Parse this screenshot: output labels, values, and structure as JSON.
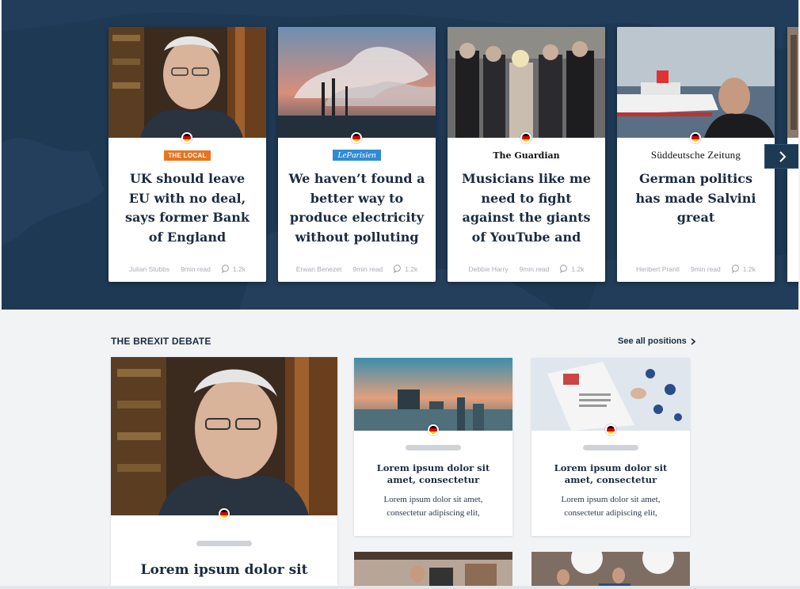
{
  "hero": {
    "next_label": "next",
    "cards": [
      {
        "source": "THE LOCAL",
        "source_style": "local",
        "title": "UK should leave EU with no deal, says former Bank of England governor",
        "author": "Julian Stubbs",
        "read_time": "9min read",
        "comments": "1.2k",
        "flag": "germany-flag-icon"
      },
      {
        "source": "LeParisien",
        "source_style": "parisien",
        "title": "We haven’t found a better way to produce electricity without polluting",
        "author": "Erwan Benezet",
        "read_time": "9min read",
        "comments": "1.2k",
        "flag": "germany-flag-icon"
      },
      {
        "source": "The Guardian",
        "source_style": "guardian",
        "title": "Musicians like me need to fight against the giants of YouTube and",
        "author": "Debbie Harry",
        "read_time": "9min read",
        "comments": "1.2k",
        "flag": "germany-flag-icon"
      },
      {
        "source": "Süddeutsche Zeitung",
        "source_style": "sz",
        "title": "German politics has made Salvini great",
        "author": "Heribert Prantl",
        "read_time": "9min read",
        "comments": "1.2k",
        "flag": "germany-flag-icon"
      }
    ]
  },
  "section": {
    "title": "THE BREXIT DEBATE",
    "see_all": "See all positions",
    "feature": {
      "title": "Lorem ipsum dolor sit"
    },
    "small_cards": [
      {
        "title": "Lorem ipsum dolor sit amet, consectetur",
        "excerpt": "Lorem ipsum dolor sit amet, consectetur adipiscing elit,"
      },
      {
        "title": "Lorem ipsum dolor sit amet, consectetur",
        "excerpt": "Lorem ipsum dolor sit amet, consectetur adipiscing elit,"
      }
    ]
  },
  "colors": {
    "hero_bg": "#1e3954",
    "page_bg": "#f2f3f5",
    "text": "#1c2b40",
    "local_orange": "#e8741d",
    "parisien_blue": "#2f8bd6"
  }
}
